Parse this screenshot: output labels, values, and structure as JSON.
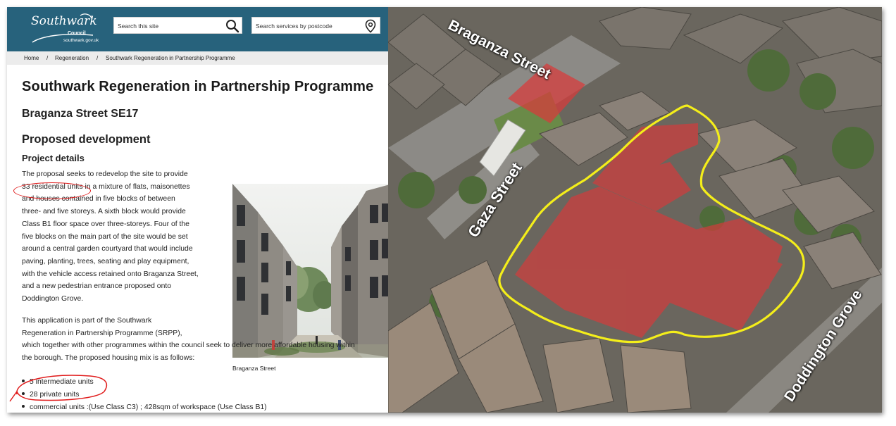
{
  "header": {
    "logo": {
      "brand": "Southwark",
      "sub": "Council",
      "url": "southwark.gov.uk"
    },
    "search_site": {
      "placeholder": "Search this site",
      "icon": "search-icon"
    },
    "search_postcode": {
      "placeholder": "Search services by postcode",
      "icon": "map-pin-icon"
    },
    "colors": {
      "header_bg": "#27627c",
      "breadcrumb_bg": "#ececec"
    }
  },
  "breadcrumb": {
    "items": [
      "Home",
      "Regeneration",
      "Southwark Regeneration in Partnership Programme"
    ],
    "separator": "/"
  },
  "page": {
    "title": "Southwark Regeneration in Partnership Programme",
    "subtitle": "Braganza Street SE17",
    "section_heading": "Proposed development",
    "subsection_heading": "Project details",
    "para1": {
      "prefix": "The proposal seeks to redevelop the site to provide",
      "highlight": "33 residential units",
      "lines": [
        "in a mixture of flats, maisonettes",
        "and houses contained in five blocks of between",
        "three- and five storeys. A sixth block would provide",
        "Class B1 floor space over three-storeys. Four of the",
        "five blocks on the main part of the site would be set",
        "around a central garden courtyard that would include",
        "paving, planting, trees, seating and play equipment,",
        "with the vehicle access retained onto Braganza Street,",
        "and a new pedestrian entrance proposed onto",
        "Doddington Grove."
      ]
    },
    "para2": {
      "lines": [
        "This application is part of the Southwark",
        "Regeneration in Partnership Programme (SRPP),",
        "which together with other programmes within the council seek to deliver more affordable housing within",
        "the borough. The proposed housing mix is as follows:"
      ]
    },
    "housing_mix": [
      "5  intermediate units",
      "28 private units",
      "commercial units :(Use Class C3) ; 428sqm of workspace (Use Class B1)"
    ],
    "photo_caption": "Braganza Street",
    "annotation_color": "#e01b1b"
  },
  "map": {
    "street_labels": [
      "Braganza Street",
      "Gaza Street",
      "Doddington Grove"
    ],
    "boundary_color": "#f4ee1a",
    "building_overlay_color": "#d93a3a"
  }
}
